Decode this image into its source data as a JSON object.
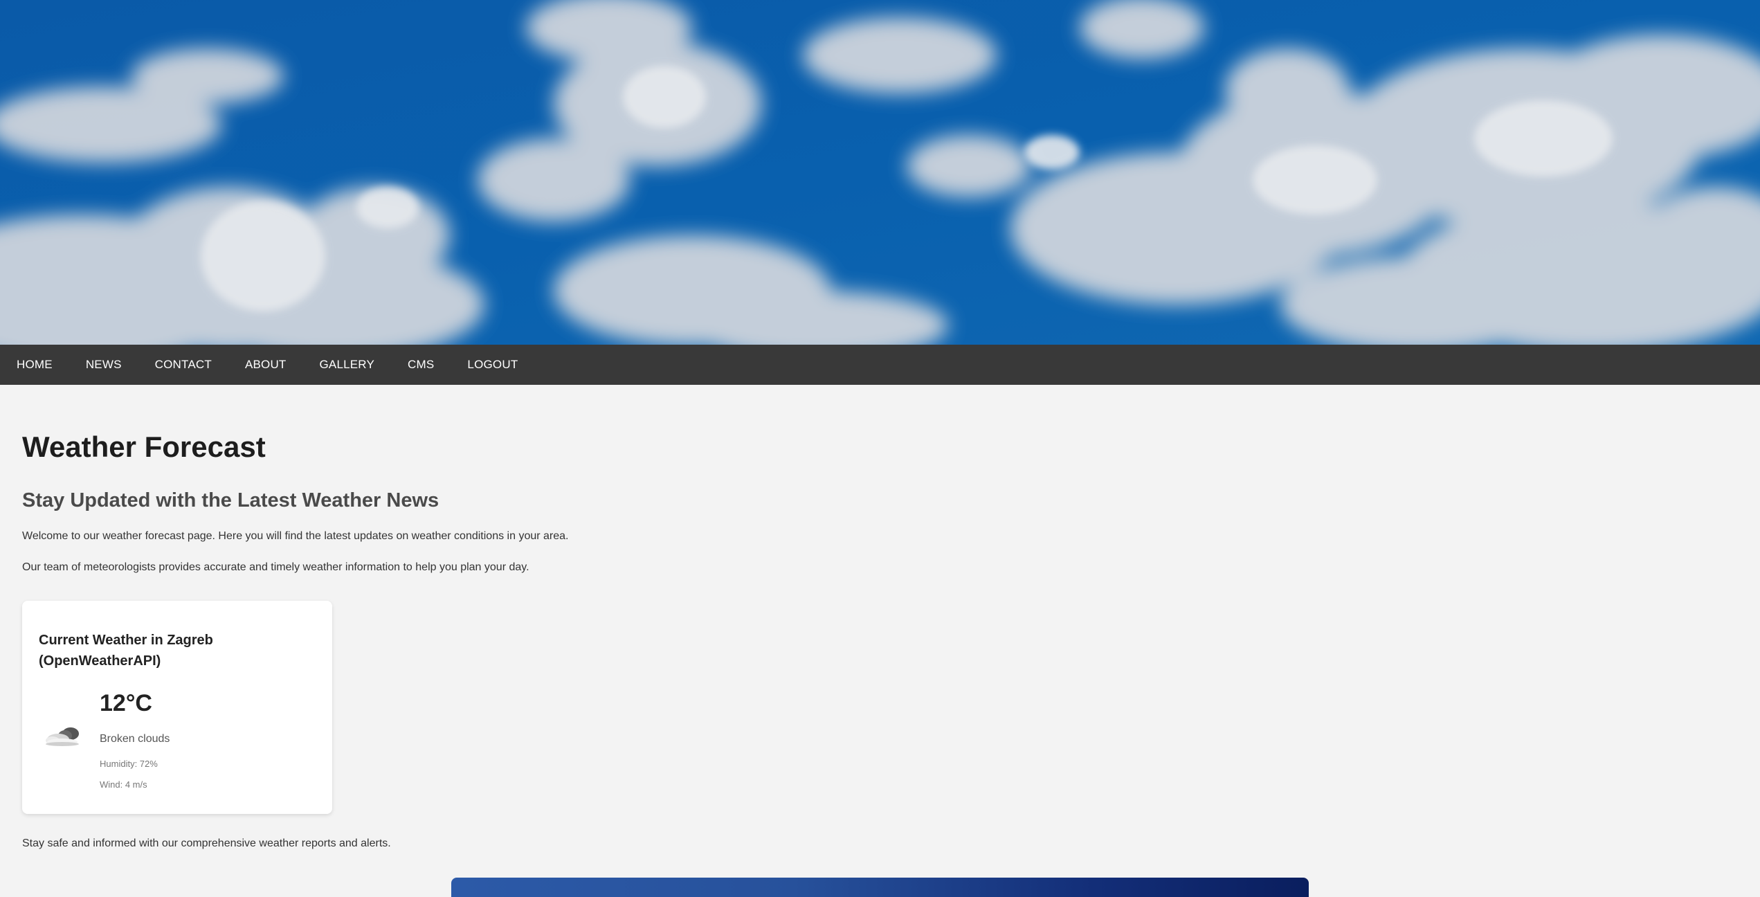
{
  "nav": {
    "items": [
      {
        "label": "HOME"
      },
      {
        "label": "NEWS"
      },
      {
        "label": "CONTACT"
      },
      {
        "label": "ABOUT"
      },
      {
        "label": "GALLERY"
      },
      {
        "label": "CMS"
      },
      {
        "label": "LOGOUT"
      }
    ]
  },
  "main": {
    "title": "Weather Forecast",
    "subtitle": "Stay Updated with the Latest Weather News",
    "intro_1": "Welcome to our weather forecast page. Here you will find the latest updates on weather conditions in your area.",
    "intro_2": "Our team of meteorologists provides accurate and timely weather information to help you plan your day.",
    "footer_text": "Stay safe and informed with our comprehensive weather reports and alerts."
  },
  "weather_card": {
    "title": "Current Weather in Zagreb (OpenWeatherAPI)",
    "temperature": "12°C",
    "description": "Broken clouds",
    "humidity": "Humidity: 72%",
    "wind": "Wind: 4 m/s",
    "icon": "broken-clouds-icon"
  },
  "colors": {
    "navbar": "#393939",
    "page_background": "#f3f3f3",
    "sky": "#0b5aa6"
  }
}
